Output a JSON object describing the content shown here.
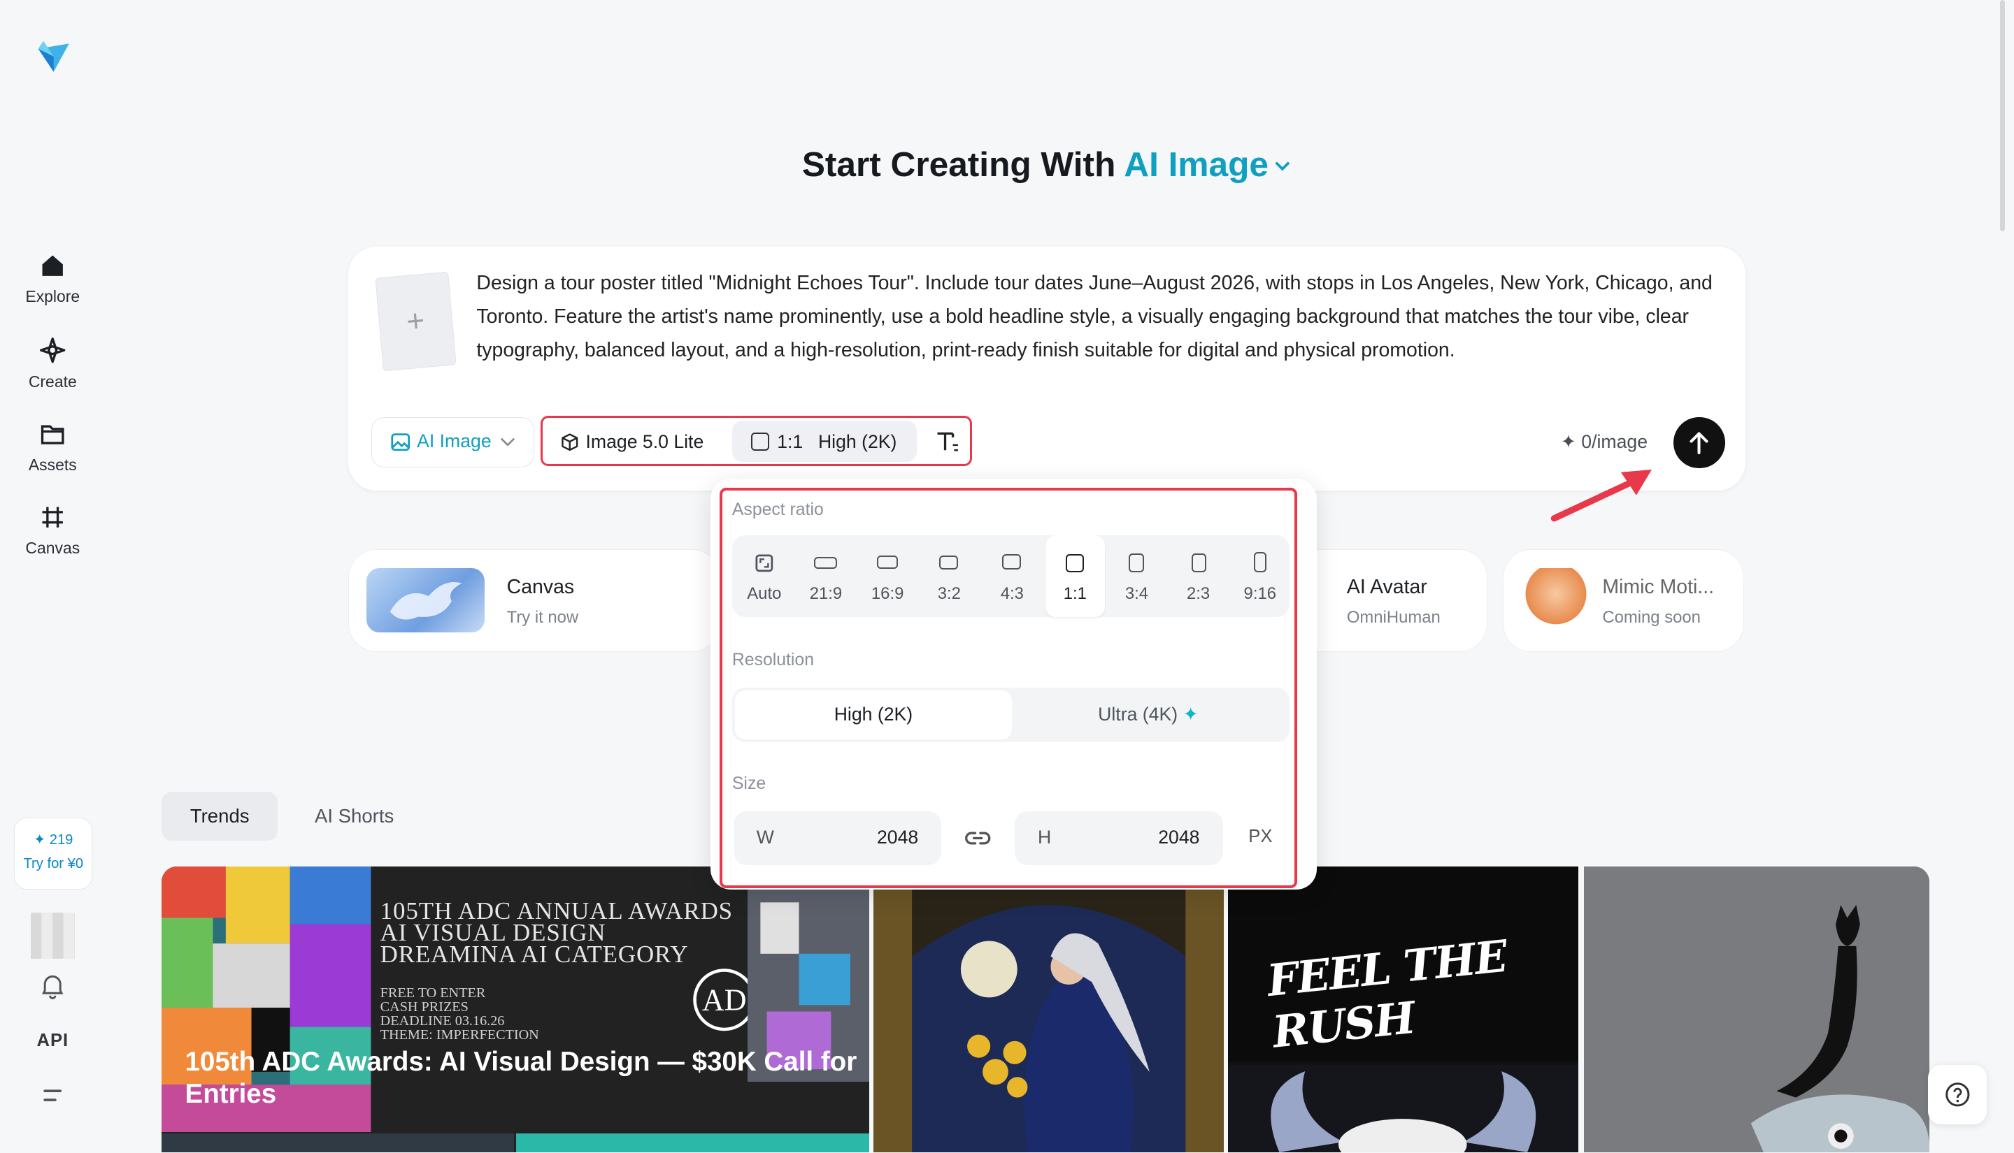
{
  "sidebar": {
    "logo": "paper-plane-logo",
    "items": [
      {
        "label": "Explore",
        "icon": "home-icon"
      },
      {
        "label": "Create",
        "icon": "sparkle-icon"
      },
      {
        "label": "Assets",
        "icon": "folder-icon"
      },
      {
        "label": "Canvas",
        "icon": "crop-icon"
      }
    ],
    "credits": {
      "count": "219",
      "offer": "Try for ¥0"
    },
    "api_label": "API"
  },
  "header": {
    "title_prefix": "Start Creating With",
    "title_accent": "AI Image"
  },
  "prompt": {
    "text": "Design a tour poster titled \"Midnight Echoes Tour\". Include tour dates June–August 2026, with stops in Los Angeles, New York, Chicago, and Toronto. Feature the artist's name prominently, use a bold headline style, a visually engaging background that matches the tour vibe, clear typography, balanced layout, and a high-resolution, print-ready finish suitable for digital and physical promotion.",
    "add_reference": "+"
  },
  "toolbar": {
    "mode_label": "AI Image",
    "model_label": "Image 5.0 Lite",
    "ratio_label": "1:1",
    "quality_label": "High (2K)",
    "cost_label": "0/image"
  },
  "features": [
    {
      "title": "Canvas",
      "subtitle": "Try it now"
    },
    {
      "title": "AI Avatar",
      "subtitle": "OmniHuman"
    },
    {
      "title": "Mimic Moti...",
      "subtitle": "Coming soon"
    }
  ],
  "popover": {
    "aspect_label": "Aspect ratio",
    "ratios": [
      "Auto",
      "21:9",
      "16:9",
      "3:2",
      "4:3",
      "1:1",
      "3:4",
      "2:3",
      "9:16"
    ],
    "selected_ratio": "1:1",
    "resolution_label": "Resolution",
    "resolutions": [
      "High (2K)",
      "Ultra (4K)"
    ],
    "selected_resolution": "High (2K)",
    "size_label": "Size",
    "width_key": "W",
    "width_value": "2048",
    "height_key": "H",
    "height_value": "2048",
    "unit": "PX"
  },
  "tabs": [
    "Trends",
    "AI Shorts"
  ],
  "gallery": {
    "featured_title": "105th ADC Awards: AI Visual Design — $30K Call for Entries",
    "poster_lines": [
      "105TH ADC ANNUAL AWARDS",
      "AI VISUAL DESIGN",
      "DREAMINA AI CATEGORY"
    ],
    "poster_small_lines": [
      "FREE TO ENTER",
      "CASH PRIZES",
      "DEADLINE 03.16.26",
      "THEME: IMPERFECTION"
    ],
    "feel_the_rush": "FEEL THE RUSH"
  },
  "colors": {
    "accent": "#0f9fc0",
    "highlight": "#e8394b",
    "send": "#111111"
  }
}
